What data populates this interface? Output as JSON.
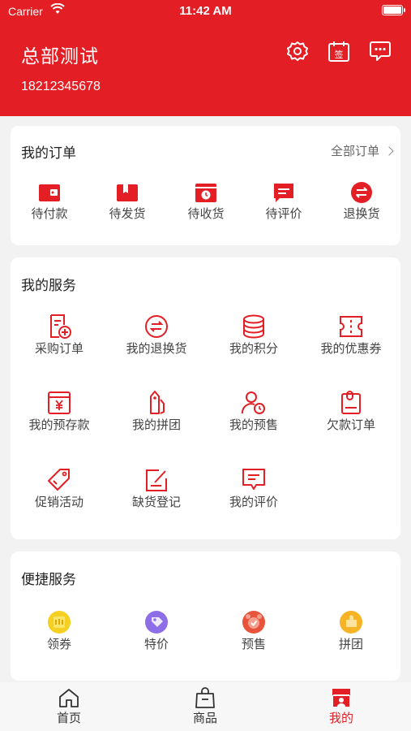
{
  "status_bar": {
    "carrier": "Carrier",
    "time": "11:42 AM"
  },
  "header": {
    "shop_name": "总部测试",
    "phone": "18212345678"
  },
  "orders": {
    "title": "我的订单",
    "all_label": "全部订单",
    "items": [
      {
        "label": "待付款",
        "icon": "wallet-icon"
      },
      {
        "label": "待发货",
        "icon": "package-icon"
      },
      {
        "label": "待收货",
        "icon": "delivery-clock-icon"
      },
      {
        "label": "待评价",
        "icon": "comment-icon"
      },
      {
        "label": "退换货",
        "icon": "exchange-icon"
      }
    ]
  },
  "services": {
    "title": "我的服务",
    "items": [
      {
        "label": "采购订单",
        "icon": "purchase-order-icon"
      },
      {
        "label": "我的退换货",
        "icon": "exchange-icon"
      },
      {
        "label": "我的积分",
        "icon": "coins-icon"
      },
      {
        "label": "我的优惠券",
        "icon": "coupon-icon"
      },
      {
        "label": "我的预存款",
        "icon": "deposit-icon"
      },
      {
        "label": "我的拼团",
        "icon": "group-tag-icon"
      },
      {
        "label": "我的预售",
        "icon": "presale-user-icon"
      },
      {
        "label": "欠款订单",
        "icon": "debt-clipboard-icon"
      },
      {
        "label": "促销活动",
        "icon": "promo-tag-icon"
      },
      {
        "label": "缺货登记",
        "icon": "register-edit-icon"
      },
      {
        "label": "我的评价",
        "icon": "review-icon"
      }
    ]
  },
  "quick": {
    "title": "便捷服务",
    "items": [
      {
        "label": "领券",
        "icon": "coupon-bubble-icon",
        "color": "#f5d020"
      },
      {
        "label": "特价",
        "icon": "special-price-icon",
        "color": "#8e6ee6"
      },
      {
        "label": "预售",
        "icon": "presale-alarm-icon",
        "color": "#e8533b"
      },
      {
        "label": "拼团",
        "icon": "group-puzzle-icon",
        "color": "#f5b325"
      }
    ]
  },
  "nav": {
    "items": [
      {
        "label": "首页",
        "icon": "home-icon"
      },
      {
        "label": "商品",
        "icon": "bag-icon"
      },
      {
        "label": "我的",
        "icon": "shop-user-icon",
        "active": true
      }
    ]
  },
  "colors": {
    "brand": "#e31e24",
    "background": "#f2f2f2"
  }
}
